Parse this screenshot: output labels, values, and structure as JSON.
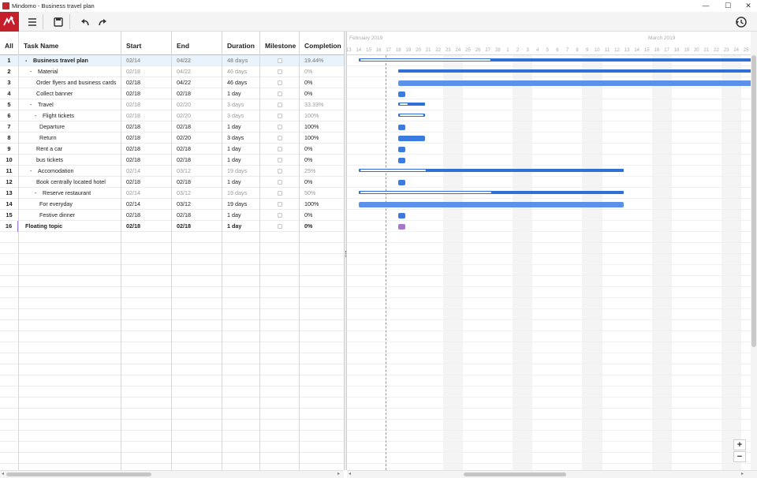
{
  "window": {
    "title": "Mindomo - Business travel plan",
    "controls": [
      "minimize",
      "maximize",
      "close"
    ]
  },
  "toolbar": {
    "buttons": [
      "menu-icon",
      "save-icon",
      "undo-icon",
      "redo-icon"
    ],
    "right": "history-icon"
  },
  "table": {
    "headers": {
      "idx": "All",
      "name": "Task Name",
      "start": "Start",
      "end": "End",
      "duration": "Duration",
      "milestone": "Milestone",
      "completion": "Completion"
    },
    "rows": [
      {
        "idx": "1",
        "name": "Business travel plan",
        "toggle": "-",
        "level": 1,
        "start": "02/14",
        "end": "04/22",
        "duration": "48 days",
        "completion": "19.44%",
        "kind": "root"
      },
      {
        "idx": "2",
        "name": "Material",
        "toggle": "-",
        "level": 2,
        "start": "02/18",
        "end": "04/22",
        "duration": "46 days",
        "completion": "0%",
        "kind": "summary"
      },
      {
        "idx": "3",
        "name": "Order flyers and business cards",
        "toggle": "",
        "level": 3,
        "start": "02/18",
        "end": "04/22",
        "duration": "46 days",
        "completion": "0%",
        "kind": "task"
      },
      {
        "idx": "4",
        "name": "Collect banner",
        "toggle": "",
        "level": 3,
        "start": "02/18",
        "end": "02/18",
        "duration": "1 day",
        "completion": "0%",
        "kind": "task"
      },
      {
        "idx": "5",
        "name": "Travel",
        "toggle": "-",
        "level": 2,
        "start": "02/18",
        "end": "02/20",
        "duration": "3 days",
        "completion": "33.33%",
        "kind": "summary"
      },
      {
        "idx": "6",
        "name": "Flight tickets",
        "toggle": "-",
        "level": 3,
        "start": "02/18",
        "end": "02/20",
        "duration": "3 days",
        "completion": "100%",
        "kind": "summary"
      },
      {
        "idx": "7",
        "name": "Departure",
        "toggle": "",
        "level": 4,
        "start": "02/18",
        "end": "02/18",
        "duration": "1 day",
        "completion": "100%",
        "kind": "task"
      },
      {
        "idx": "8",
        "name": "Return",
        "toggle": "",
        "level": 4,
        "start": "02/18",
        "end": "02/20",
        "duration": "3 days",
        "completion": "100%",
        "kind": "task"
      },
      {
        "idx": "9",
        "name": "Rent a car",
        "toggle": "",
        "level": 3,
        "start": "02/18",
        "end": "02/18",
        "duration": "1 day",
        "completion": "0%",
        "kind": "task"
      },
      {
        "idx": "10",
        "name": "bus tickets",
        "toggle": "",
        "level": 3,
        "start": "02/18",
        "end": "02/18",
        "duration": "1 day",
        "completion": "0%",
        "kind": "task"
      },
      {
        "idx": "11",
        "name": "Accomodation",
        "toggle": "-",
        "level": 2,
        "start": "02/14",
        "end": "03/12",
        "duration": "19 days",
        "completion": "25%",
        "kind": "summary"
      },
      {
        "idx": "12",
        "name": "Book centrally located hotel",
        "toggle": "",
        "level": 3,
        "start": "02/18",
        "end": "02/18",
        "duration": "1 day",
        "completion": "0%",
        "kind": "task"
      },
      {
        "idx": "13",
        "name": "Reserve restaurant",
        "toggle": "-",
        "level": 3,
        "start": "02/14",
        "end": "03/12",
        "duration": "19 days",
        "completion": "50%",
        "kind": "summary"
      },
      {
        "idx": "14",
        "name": "For everyday",
        "toggle": "",
        "level": 4,
        "start": "02/14",
        "end": "03/12",
        "duration": "19 days",
        "completion": "100%",
        "kind": "task"
      },
      {
        "idx": "15",
        "name": "Festive dinner",
        "toggle": "",
        "level": 4,
        "start": "02/18",
        "end": "02/18",
        "duration": "1 day",
        "completion": "0%",
        "kind": "task"
      },
      {
        "idx": "16",
        "name": "Floating topic",
        "toggle": "",
        "level": 1,
        "start": "02/18",
        "end": "02/18",
        "duration": "1 day",
        "completion": "0%",
        "kind": "floating"
      }
    ]
  },
  "gantt": {
    "months": [
      "February 2019",
      "March 2019"
    ],
    "days": [
      "13",
      "14",
      "15",
      "16",
      "17",
      "18",
      "19",
      "20",
      "21",
      "22",
      "23",
      "24",
      "25",
      "26",
      "27",
      "28",
      "1",
      "2",
      "3",
      "4",
      "5",
      "6",
      "7",
      "8",
      "9",
      "10",
      "11",
      "12",
      "13",
      "14",
      "15",
      "16",
      "17",
      "18",
      "19",
      "20",
      "21",
      "22",
      "23",
      "24",
      "25"
    ],
    "colors": {
      "summary": "#2f6fd6",
      "task": "#3b7be0",
      "floating": "#a679c8"
    },
    "weekend_day_indices": [
      10,
      11,
      17,
      18,
      24,
      25,
      31,
      32,
      38,
      39
    ],
    "today_day_index": 3.7
  },
  "zoom": {
    "plus": "+",
    "minus": "−"
  }
}
